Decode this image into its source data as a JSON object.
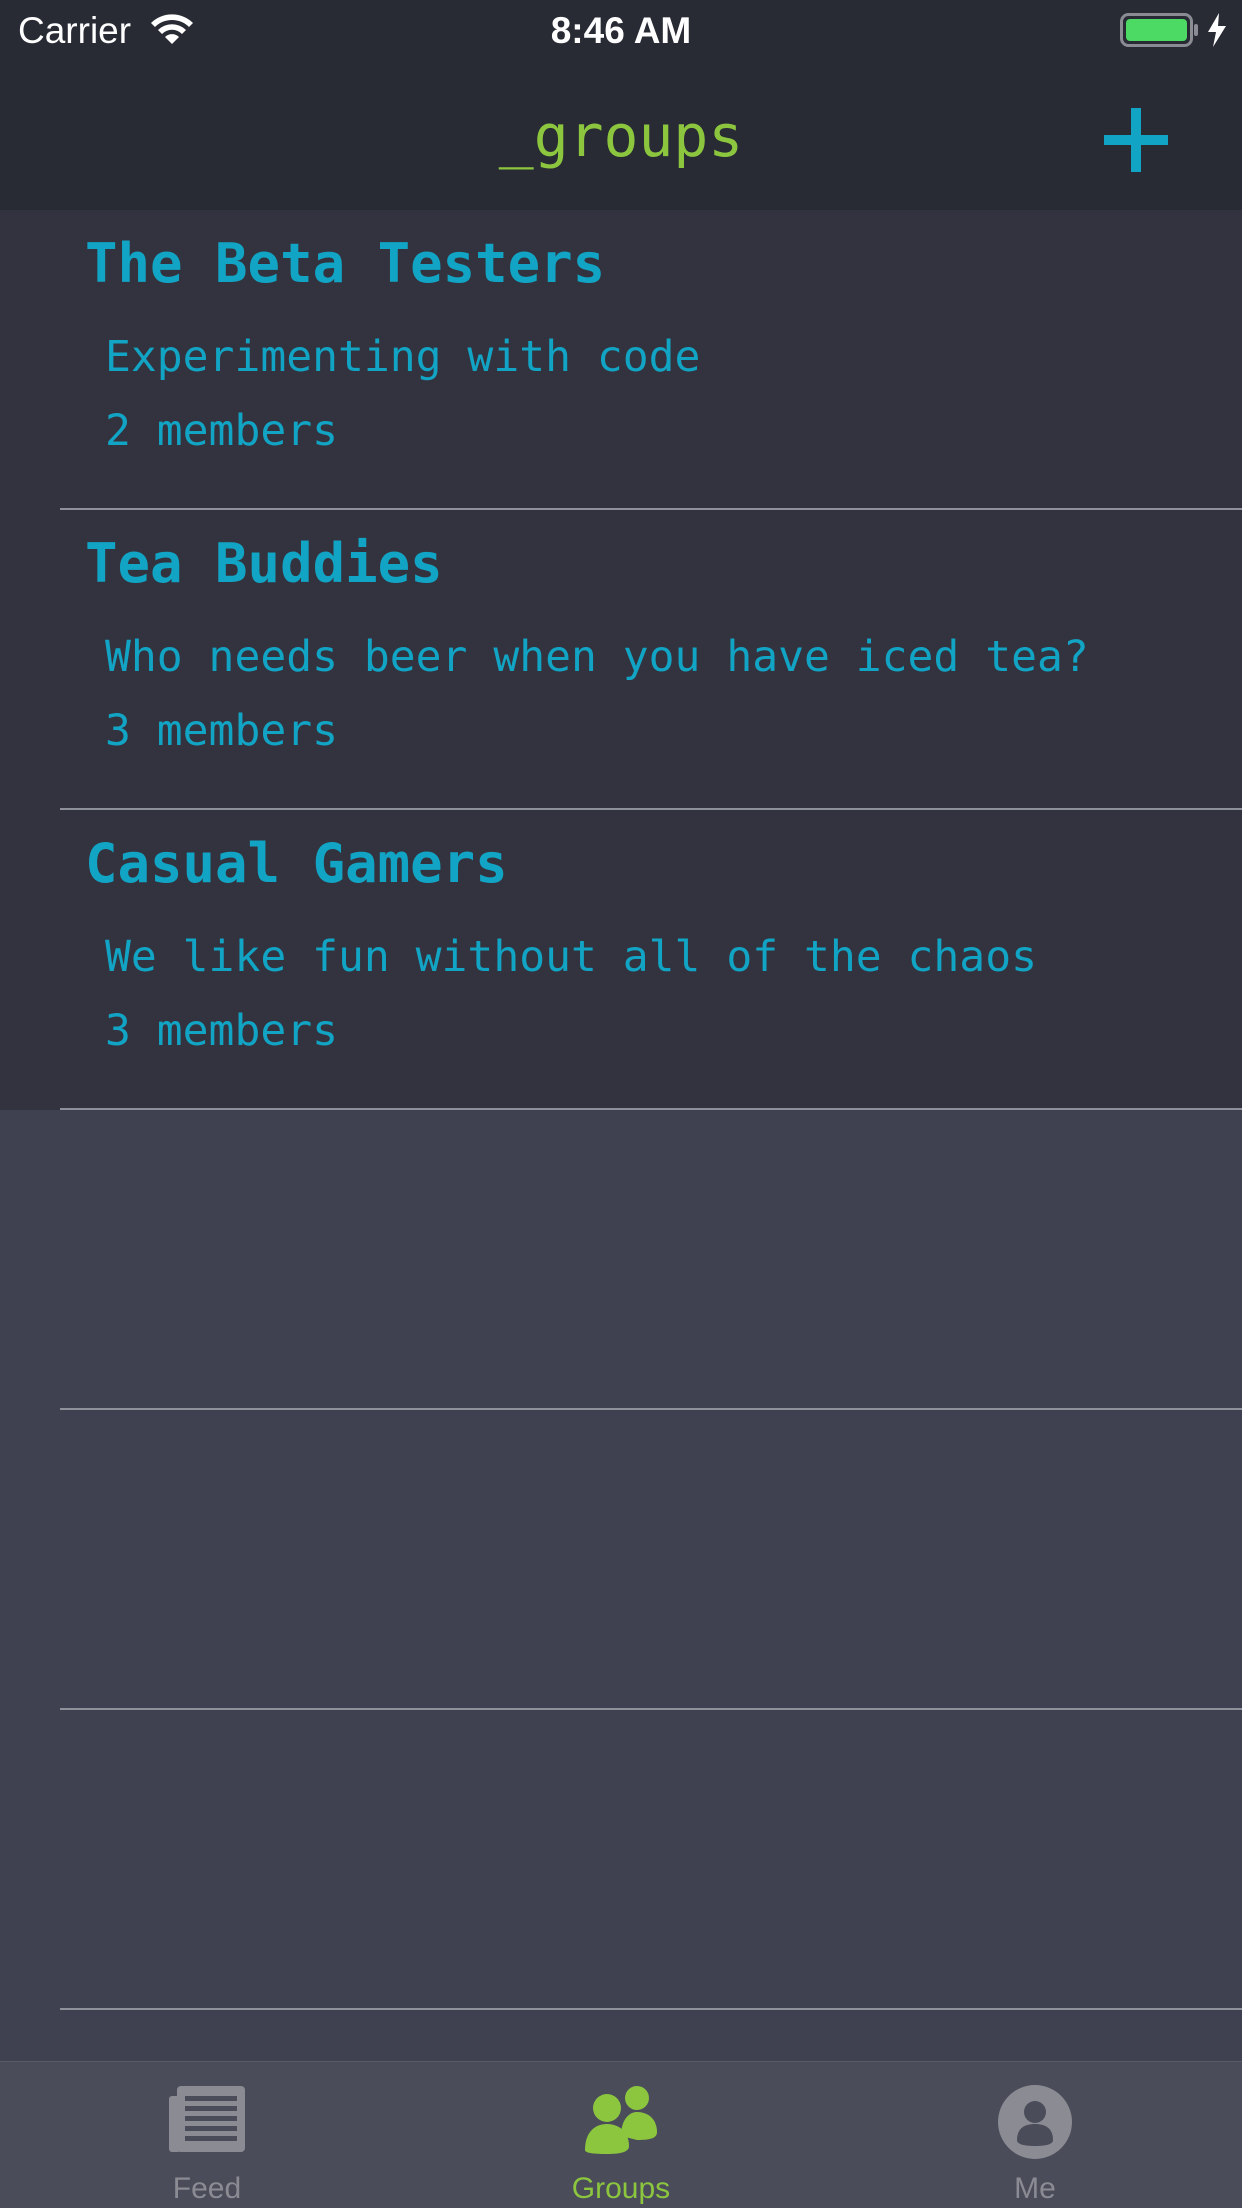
{
  "status_bar": {
    "carrier": "Carrier",
    "time": "8:46 AM",
    "battery_color": "#4cd964"
  },
  "nav": {
    "title": "_groups",
    "title_color": "#8cc63f",
    "add_icon": "plus-icon"
  },
  "groups": [
    {
      "name": "The Beta Testers",
      "description": "Experimenting with code",
      "members": "2 members"
    },
    {
      "name": "Tea Buddies",
      "description": "Who needs beer when you have iced tea?",
      "members": "3 members"
    },
    {
      "name": "Casual Gamers",
      "description": "We like fun without all of the chaos",
      "members": "3 members"
    }
  ],
  "tabs": [
    {
      "label": "Feed",
      "icon": "newspaper-icon",
      "selected": false
    },
    {
      "label": "Groups",
      "icon": "group-icon",
      "selected": true
    },
    {
      "label": "Me",
      "icon": "profile-icon",
      "selected": false
    }
  ],
  "colors": {
    "accent": "#12a4c4",
    "selected_tab": "#8cc63f",
    "unselected_tab": "#8a8b93"
  }
}
